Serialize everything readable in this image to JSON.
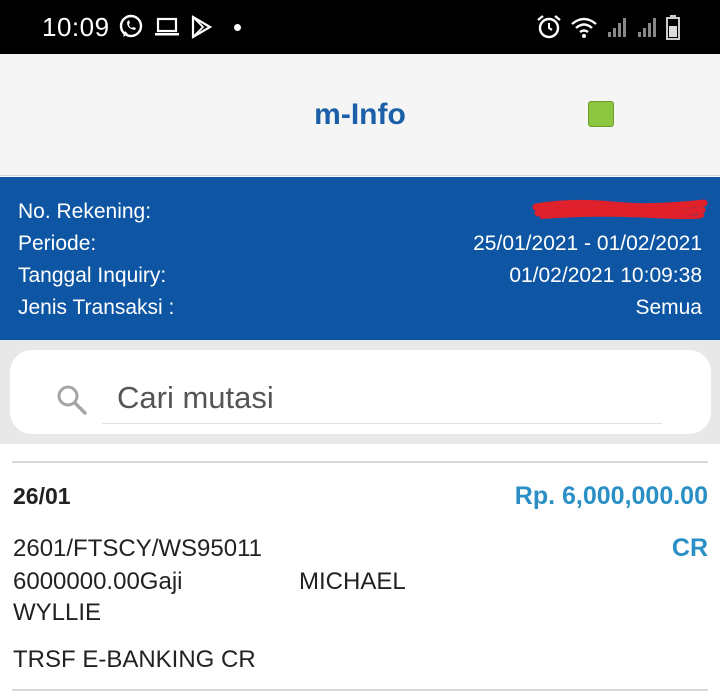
{
  "status_bar": {
    "time": "10:09",
    "left_icons": [
      "whatsapp-icon",
      "laptop-icon",
      "play-store-icon",
      "notification-dot-icon"
    ],
    "right_icons": [
      "alarm-icon",
      "wifi-icon",
      "signal-icon",
      "signal-icon",
      "battery-icon"
    ]
  },
  "app_bar": {
    "title": "m-Info",
    "status_color": "#8cc63f"
  },
  "info": {
    "account_label": "No. Rekening:",
    "period_label": "Periode:",
    "period_value": "25/01/2021 - 01/02/2021",
    "inquiry_label": "Tanggal Inquiry:",
    "inquiry_value": "01/02/2021 10:09:38",
    "type_label": "Jenis Transaksi :",
    "type_value": "Semua"
  },
  "search": {
    "placeholder": "Cari mutasi"
  },
  "transactions": [
    {
      "date": "26/01",
      "amount": "Rp. 6,000,000.00",
      "type": "CR",
      "line1": "2601/FTSCY/WS95011",
      "line2": "6000000.00Gaji",
      "name": "MICHAEL",
      "line3": "WYLLIE",
      "line4": "TRSF E-BANKING CR"
    }
  ],
  "colors": {
    "header_blue": "#0e56a3",
    "title_blue": "#1a5fa8",
    "amount_blue": "#2a8fc5",
    "redaction_red": "#e0202a"
  }
}
